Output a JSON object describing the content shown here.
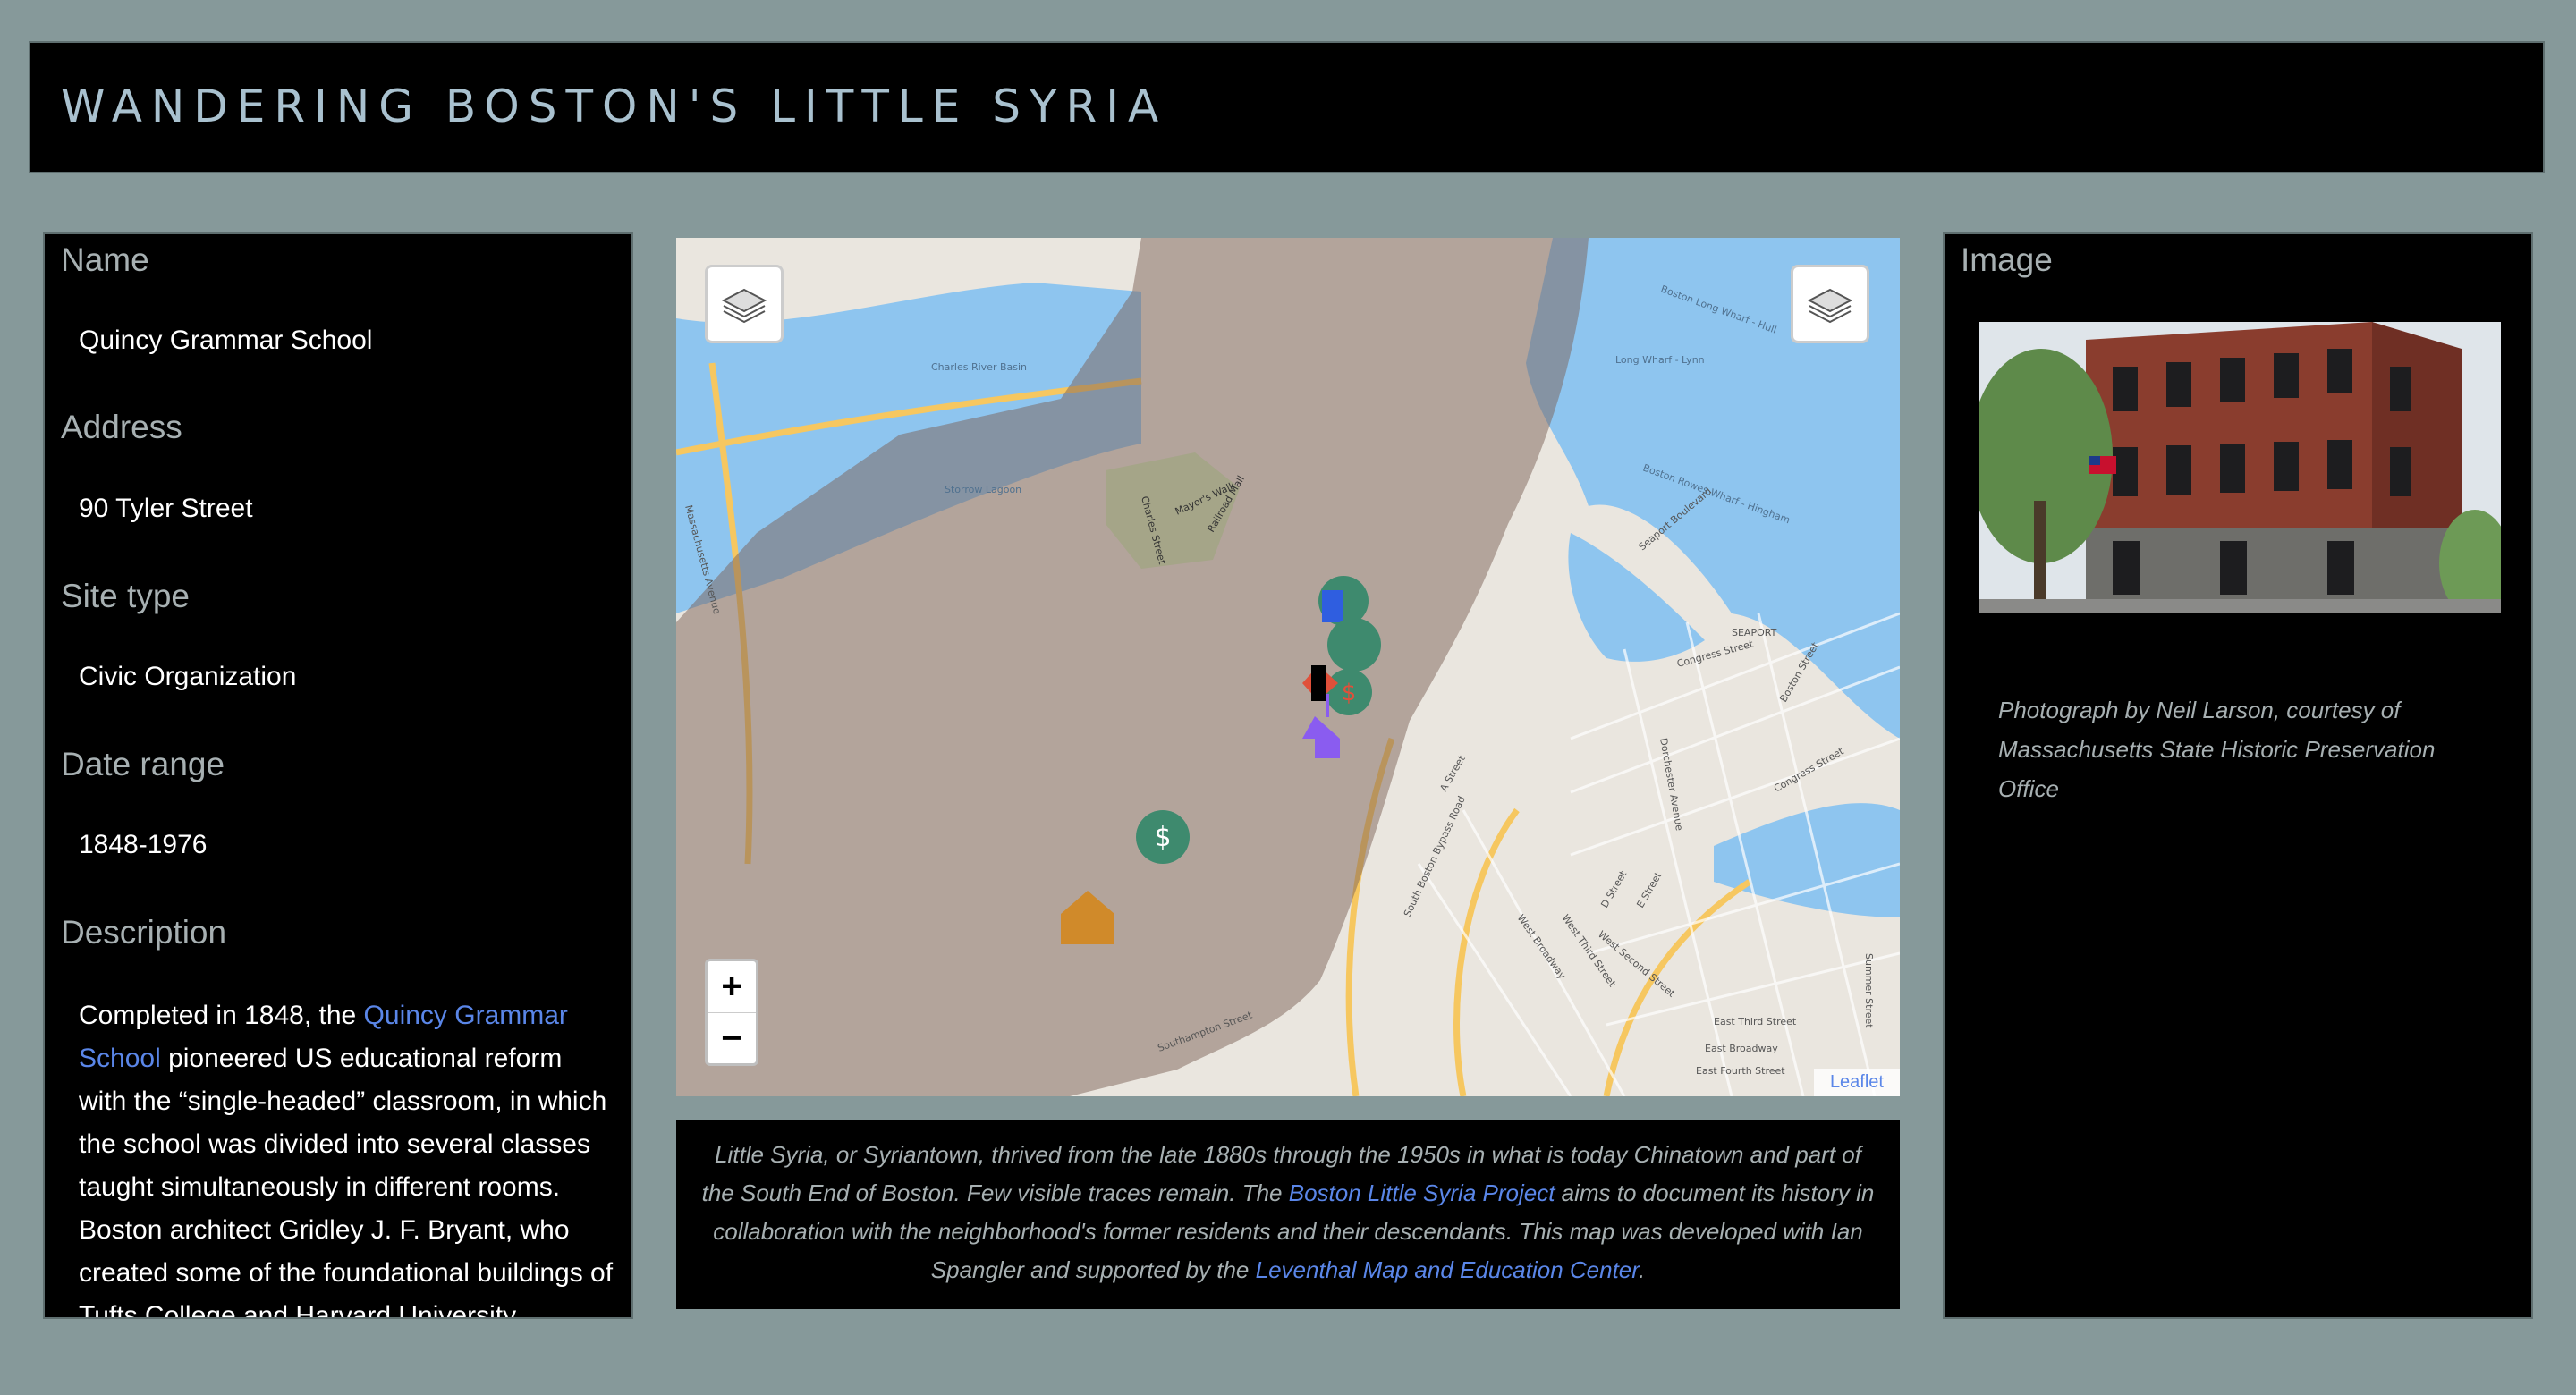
{
  "header": {
    "title": "WANDERING BOSTON'S LITTLE SYRIA"
  },
  "details": {
    "name_label": "Name",
    "name_value": "Quincy Grammar School",
    "address_label": "Address",
    "address_value": "90 Tyler Street",
    "site_type_label": "Site type",
    "site_type_value": "Civic Organization",
    "date_range_label": "Date range",
    "date_range_value": "1848-1976",
    "description_label": "Description",
    "description_pre": "Completed in 1848, the ",
    "description_link": "Quincy Grammar School",
    "description_post": " pioneered US educational reform with the “single-headed” classroom, in which the school was divided into several classes taught simultaneously in different rooms. Boston architect Gridley J. F. Bryant, who created some of the foundational buildings of Tufts College and Harvard University"
  },
  "map": {
    "zoom_in": "+",
    "zoom_out": "−",
    "attribution": "Leaflet",
    "labels": {
      "charles_river_basin": "Charles River Basin",
      "storrow_lagoon": "Storrow Lagoon",
      "mayors_walk": "Mayor's Walk",
      "railroad_mall": "Railroad Mall",
      "charles_street": "Charles Street",
      "boston_long_wharf_hull": "Boston Long Wharf - Hull",
      "long_wharf_lynn": "Long Wharf - Lynn",
      "boston_rowes_wharf_hingham": "Boston Rowes Wharf - Hingham",
      "seaport": "SEAPORT",
      "congress_street": "Congress Street",
      "seaport_boulevard": "Seaport Boulevard",
      "summer_street": "Summer Street",
      "a_street": "A Street",
      "d_street": "D Street",
      "e_street": "E Street",
      "west_broadway": "West Broadway",
      "west_third_street": "West Third Street",
      "west_second_street": "West Second Street",
      "east_third_street": "East Third Street",
      "east_broadway": "East Broadway",
      "east_fourth_street": "East Fourth Street",
      "massachusetts_avenue": "Massachusetts Avenue",
      "southampton_street": "Southampton Street",
      "south_boston_bypass_road": "South Boston Bypass Road",
      "dorchester_avenue": "Dorchester Avenue",
      "boston_street": "Boston Street",
      "congress_street_2": "Congress Street"
    },
    "marker_colors": {
      "green": "#3e8a6e",
      "orange": "#d08a2a",
      "purple": "#8a5cf0",
      "red": "#e0503a",
      "blue": "#2f5ee0"
    }
  },
  "caption": {
    "text1": "Little Syria, or Syriantown, thrived from the late 1880s through the 1950s in what is today Chinatown and part of the South End of Boston. Few visible traces remain. The ",
    "link1": "Boston Little Syria Project",
    "text2": " aims to document its history in collaboration with the neighborhood's former residents and their descendants. This map was developed with Ian Spangler and supported by the ",
    "link2": "Leventhal Map and Education Center",
    "text3": "."
  },
  "image_panel": {
    "label": "Image",
    "photo_caption": "Photograph by Neil Larson, courtesy of Massachusetts State Historic Preservation Office"
  }
}
